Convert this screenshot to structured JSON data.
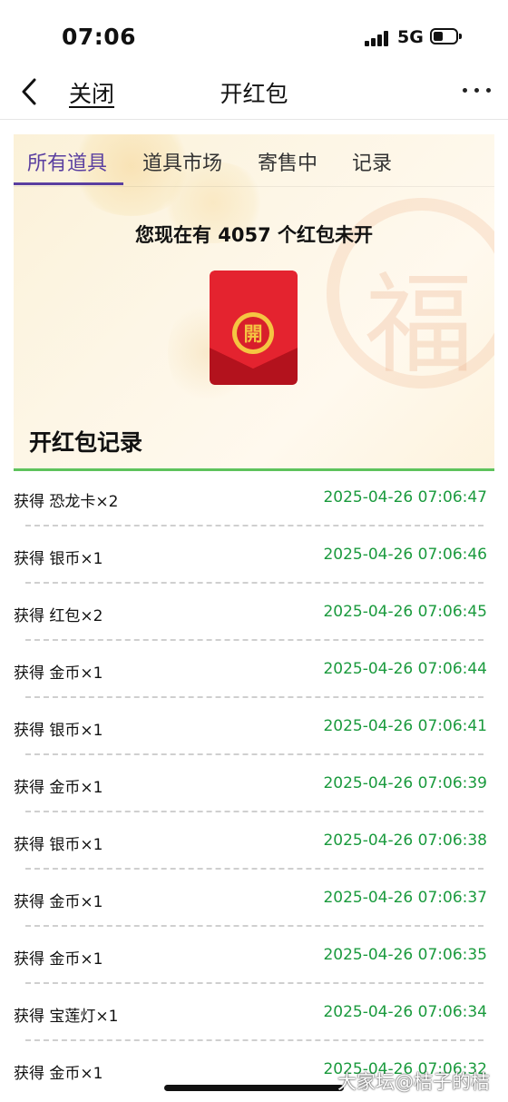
{
  "status_bar": {
    "time": "07:06",
    "network": "5G",
    "icons": [
      "signal-icon",
      "battery-icon"
    ]
  },
  "navbar": {
    "close_label": "关闭",
    "title": "开红包",
    "icons": [
      "back-chevron-icon",
      "more-dots-icon"
    ]
  },
  "tabs": [
    {
      "label": "所有道具",
      "active": true
    },
    {
      "label": "道具市场",
      "active": false
    },
    {
      "label": "寄售中",
      "active": false
    },
    {
      "label": "记录",
      "active": false
    }
  ],
  "hongbao": {
    "count_text": "您现在有 4057 个红包未开",
    "envelope_char": "開",
    "background_char": "福"
  },
  "records": {
    "title": "开红包记录",
    "items": [
      {
        "label": "获得 恐龙卡×2",
        "time": "2025-04-26 07:06:47"
      },
      {
        "label": "获得 银币×1",
        "time": "2025-04-26 07:06:46"
      },
      {
        "label": "获得 红包×2",
        "time": "2025-04-26 07:06:45"
      },
      {
        "label": "获得 金币×1",
        "time": "2025-04-26 07:06:44"
      },
      {
        "label": "获得 银币×1",
        "time": "2025-04-26 07:06:41"
      },
      {
        "label": "获得 金币×1",
        "time": "2025-04-26 07:06:39"
      },
      {
        "label": "获得 银币×1",
        "time": "2025-04-26 07:06:38"
      },
      {
        "label": "获得 金币×1",
        "time": "2025-04-26 07:06:37"
      },
      {
        "label": "获得 金币×1",
        "time": "2025-04-26 07:06:35"
      },
      {
        "label": "获得 宝莲灯×1",
        "time": "2025-04-26 07:06:34"
      },
      {
        "label": "获得 金币×1",
        "time": "2025-04-26 07:06:32"
      }
    ]
  },
  "watermark": "大家坛@桔子的桔",
  "colors": {
    "accent": "#5a3fa0",
    "time_green": "#1a9a3d",
    "divider_green": "#5ec35c",
    "envelope_red": "#d81e2b"
  }
}
